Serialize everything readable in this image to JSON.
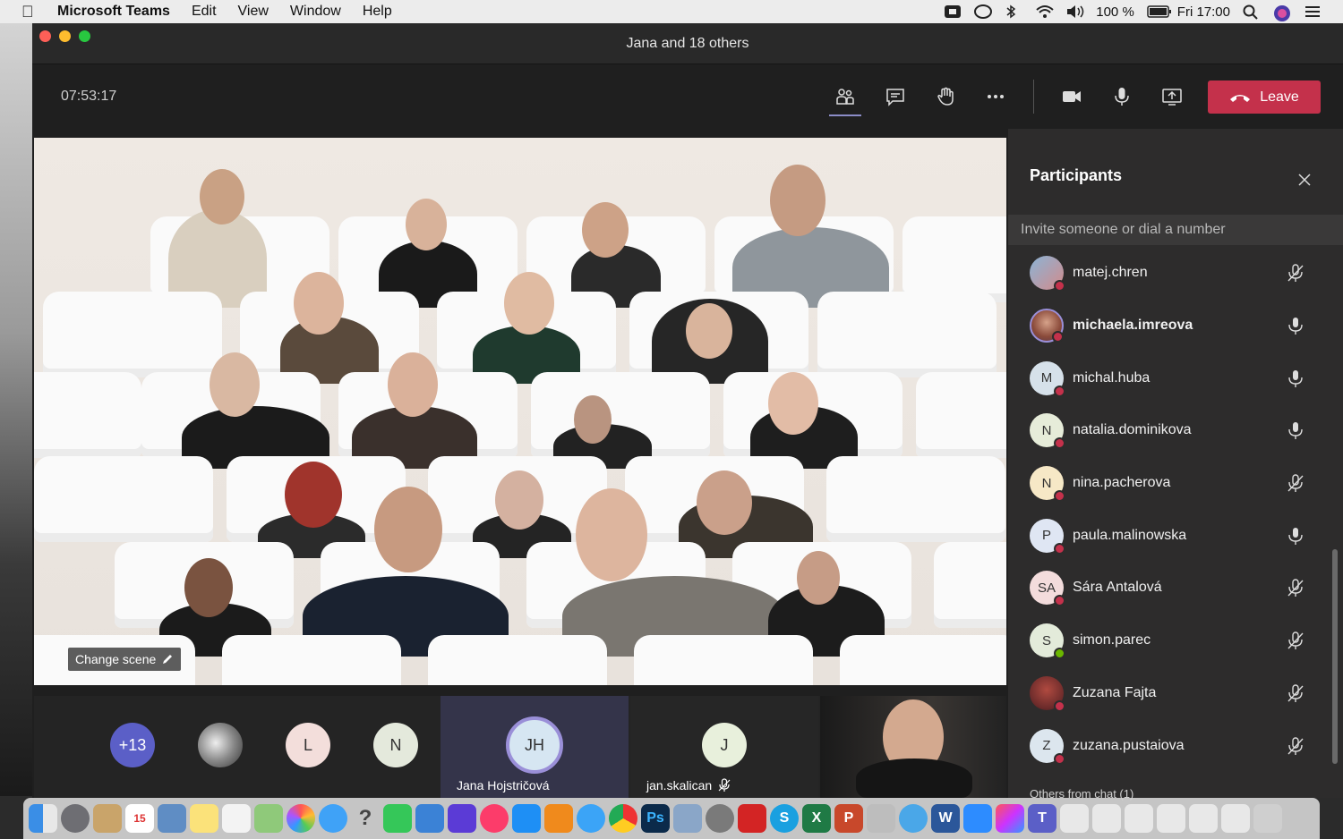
{
  "menubar": {
    "app": "Microsoft Teams",
    "items": [
      "Edit",
      "View",
      "Window",
      "Help"
    ],
    "battery": "100 %",
    "clock": "Fri 17:00"
  },
  "window": {
    "title": "Jana and 18 others"
  },
  "toolbar": {
    "timer": "07:53:17",
    "leave_label": "Leave"
  },
  "stage": {
    "change_scene_label": "Change scene"
  },
  "strip": {
    "overflow": "+13",
    "initial_l": "L",
    "initial_n": "N",
    "jana_initials": "JH",
    "jana_name": "Jana Hojstričová",
    "jan_initial": "J",
    "jan_name": "jan.skalican"
  },
  "panel": {
    "title": "Participants",
    "invite_placeholder": "Invite someone or dial a number",
    "participants": [
      {
        "name": "matej.chren",
        "initials": "",
        "muted": true
      },
      {
        "name": "michaela.imreova",
        "initials": "",
        "muted": false
      },
      {
        "name": "michal.huba",
        "initials": "M",
        "muted": false
      },
      {
        "name": "natalia.dominikova",
        "initials": "N",
        "muted": false
      },
      {
        "name": "nina.pacherova",
        "initials": "N",
        "muted": true
      },
      {
        "name": "paula.malinowska",
        "initials": "P",
        "muted": false
      },
      {
        "name": "Sára Antalová",
        "initials": "SA",
        "muted": true
      },
      {
        "name": "simon.parec",
        "initials": "S",
        "muted": true
      },
      {
        "name": "Zuzana Fajta",
        "initials": "",
        "muted": true
      },
      {
        "name": "zuzana.pustaiova",
        "initials": "Z",
        "muted": true
      }
    ],
    "others_label": "Others from chat (1)"
  },
  "colors": {
    "leave": "#c4314b",
    "accent": "#8b8cc7",
    "status_busy": "#c4314b",
    "status_available": "#6bb700"
  },
  "icons": {
    "participants": "participants-icon",
    "chat": "chat-icon",
    "raise_hand": "raise-hand-icon",
    "more": "more-icon",
    "camera": "camera-icon",
    "mic": "microphone-icon",
    "share": "share-screen-icon",
    "hangup": "hangup-icon"
  }
}
